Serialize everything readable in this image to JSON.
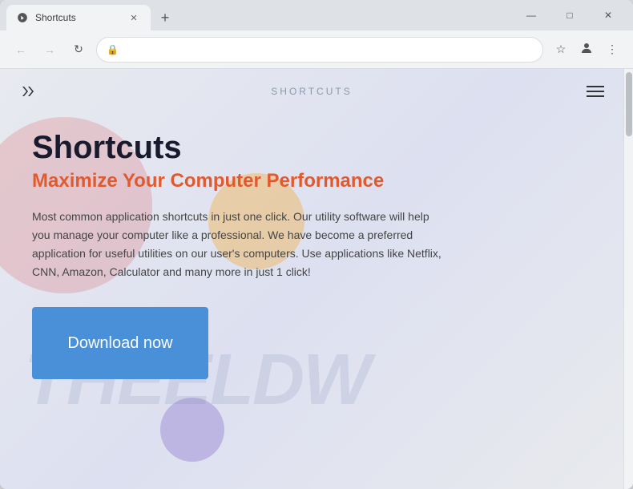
{
  "browser": {
    "tab_title": "Shortcuts",
    "tab_favicon": "arrow-icon",
    "new_tab_label": "+",
    "address_url": "",
    "window_controls": {
      "minimize": "—",
      "maximize": "□",
      "close": "✕"
    },
    "nav": {
      "back": "←",
      "forward": "→",
      "reload": "↻"
    },
    "address_icons": {
      "bookmark": "☆",
      "profile": "👤",
      "menu": "⋮"
    }
  },
  "site": {
    "nav_title": "SHORTCUTS",
    "hero_title": "Shortcuts",
    "hero_subtitle": "Maximize Your Computer Performance",
    "hero_description": "Most common application shortcuts in just one click. Our utility software will help you manage your computer like a professional. We have become a preferred application for useful utilities on our user's computers. Use applications like Netflix, CNN, Amazon, Calculator and many more in just 1 click!",
    "download_btn_label": "Download now",
    "watermark_text": "THEELDW",
    "colors": {
      "download_btn": "#4a90d9",
      "subtitle": "#e05a30"
    }
  }
}
